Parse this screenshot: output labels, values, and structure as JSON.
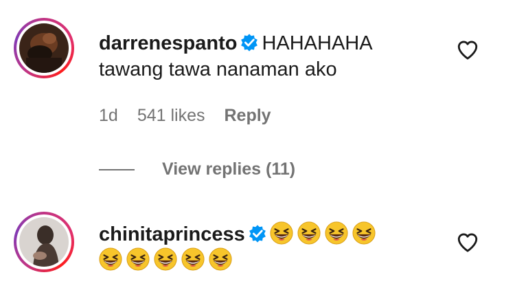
{
  "comments": [
    {
      "username": "darrenespanto",
      "verified": true,
      "text_line1": "HAHAHAHA",
      "text_line2": "tawang tawa nanaman ako",
      "time": "1d",
      "likes": "541 likes",
      "reply_label": "Reply",
      "view_replies": "View replies (11)"
    },
    {
      "username": "chinitaprincess",
      "verified": true,
      "emoji_name": "grinning-squinting-face-emoji",
      "emoji_line1_count": 4,
      "emoji_line2_count": 5
    }
  ],
  "colors": {
    "verified_blue": "#0095f6",
    "meta_gray": "#737373",
    "emoji_yellow": "#f7c52b"
  }
}
